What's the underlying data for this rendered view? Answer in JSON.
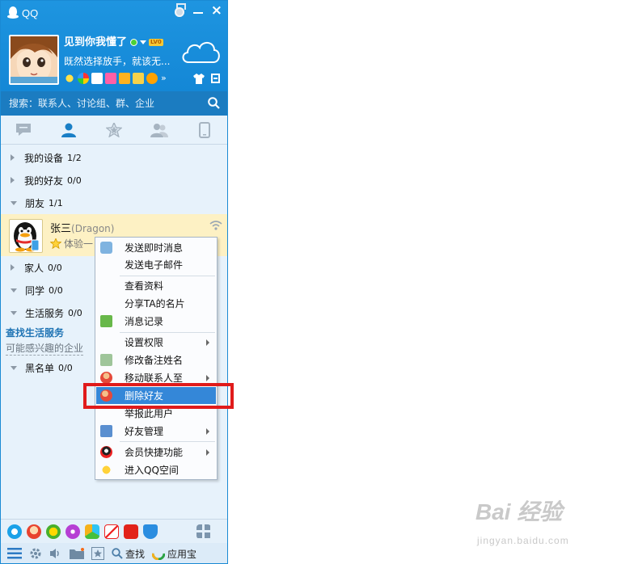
{
  "window": {
    "title": "QQ"
  },
  "profile": {
    "nickname": "见到你我懂了",
    "level_badge": "LV0",
    "signature": "既然选择放手，就该无..."
  },
  "search": {
    "placeholder": "搜索：联系人、讨论组、群、企业"
  },
  "nav_tabs": [
    "messages-icon",
    "contacts-icon",
    "favorites-icon",
    "groups-icon",
    "devices-icon"
  ],
  "groups": [
    {
      "name": "我的设备",
      "count": "1/2",
      "expanded": false
    },
    {
      "name": "我的好友",
      "count": "0/0",
      "expanded": false
    },
    {
      "name": "朋友",
      "count": "1/1",
      "expanded": true
    },
    {
      "name": "家人",
      "count": "0/0",
      "expanded": false
    },
    {
      "name": "同学",
      "count": "0/0",
      "expanded": true
    },
    {
      "name": "生活服务",
      "count": "0/0",
      "expanded": true
    },
    {
      "name": "黑名单",
      "count": "0/0",
      "expanded": true
    }
  ],
  "contact": {
    "name": "张三",
    "remark": "(Dragon)",
    "status": "体验一"
  },
  "links": {
    "find_service": "查找生活服务",
    "interested_companies": "可能感兴趣的企业"
  },
  "context_menu": {
    "items": [
      {
        "label": "发送即时消息",
        "icon": "chat-bubble-icon"
      },
      {
        "label": "发送电子邮件",
        "icon": ""
      },
      {
        "label": "查看资料",
        "icon": ""
      },
      {
        "label": "分享TA的名片",
        "icon": ""
      },
      {
        "label": "消息记录",
        "icon": "message-record-icon"
      },
      {
        "label": "设置权限",
        "icon": "",
        "submenu": true
      },
      {
        "label": "修改备注姓名",
        "icon": "edit-remark-icon"
      },
      {
        "label": "移动联系人至",
        "icon": "move-contact-icon",
        "submenu": true
      },
      {
        "label": "删除好友",
        "icon": "delete-friend-icon",
        "highlighted": true
      },
      {
        "label": "举报此用户",
        "icon": ""
      },
      {
        "label": "好友管理",
        "icon": "friend-manage-icon",
        "submenu": true
      },
      {
        "label": "会员快捷功能",
        "icon": "vip-penguin-icon",
        "submenu": true
      },
      {
        "label": "进入QQ空间",
        "icon": "qzone-star-icon"
      }
    ]
  },
  "toolbar": {
    "search_label": "查找",
    "appstore_label": "应用宝"
  },
  "watermark": {
    "logo": "Bai 经验",
    "url": "jingyan.baidu.com"
  },
  "colors": {
    "header_blue": "#1e95e0",
    "highlight": "#3487d8",
    "annotation_red": "#e01b1b",
    "contact_bg": "#fdf1c4"
  }
}
